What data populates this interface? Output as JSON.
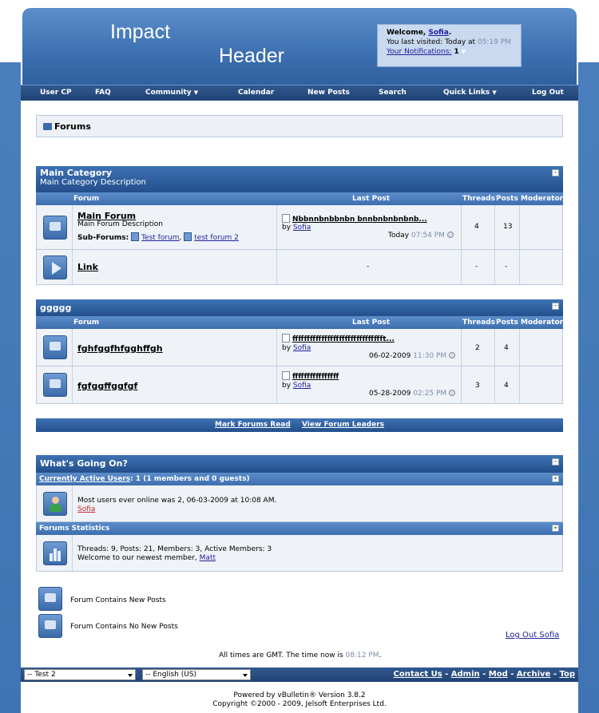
{
  "header": {
    "logo_line1": "Impact",
    "logo_line2": "Header",
    "welcome_prefix": "Welcome, ",
    "welcome_user": "Sofia",
    "last_visited_label": "You last visited: Today at ",
    "last_visited_time": "05:19 PM",
    "notifications_label": "Your Notifications:",
    "notifications_count": "1"
  },
  "nav": [
    "User CP",
    "FAQ",
    "Community",
    "Calendar",
    "New Posts",
    "Search",
    "Quick Links",
    "Log Out"
  ],
  "breadcrumb": "Forums",
  "columns": {
    "forum": "Forum",
    "last_post": "Last Post",
    "threads": "Threads",
    "posts": "Posts",
    "moderator": "Moderator"
  },
  "category1": {
    "title": "Main Category",
    "description": "Main Category Description",
    "forums": [
      {
        "name": "Main Forum",
        "description": "Main Forum Description",
        "subforums_label": "Sub-Forums:",
        "subforums": [
          "Test forum",
          "test forum 2"
        ],
        "last_post_title": "Nbbnnbnbbnbn bnnbnbnbnbnb...",
        "last_post_by": "by ",
        "last_post_user": "Sofia",
        "last_post_date": "Today",
        "last_post_time": "07:54 PM",
        "threads": "4",
        "posts": "13"
      },
      {
        "name": "Link",
        "last_post": "-",
        "threads": "-",
        "posts": "-"
      }
    ]
  },
  "category2": {
    "title": "ggggg",
    "forums": [
      {
        "name": "fghfggfhfgghffgh",
        "last_post_title": "ffffffffffffffffffffffffffffffft...",
        "last_post_by": "by ",
        "last_post_user": "Sofia",
        "last_post_date": "06-02-2009",
        "last_post_time": "11:30 PM",
        "threads": "2",
        "posts": "4"
      },
      {
        "name": "fgfggffggfgf",
        "last_post_title": "ffffffffffffffff",
        "last_post_by": "by ",
        "last_post_user": "Sofia",
        "last_post_date": "05-28-2009",
        "last_post_time": "02:25 PM",
        "threads": "3",
        "posts": "4"
      }
    ]
  },
  "actions": {
    "mark_read": "Mark Forums Read",
    "view_leaders": "View Forum Leaders"
  },
  "whats_going_on": {
    "title": "What's Going On?",
    "active_users_link": "Currently Active Users",
    "active_users_summary": ": 1 (1 members and 0 guests)",
    "most_users": "Most users ever online was 2, 06-03-2009 at 10:08 AM.",
    "active_user": "Sofia",
    "stats_title": "Forums Statistics",
    "stats_line": "Threads: 9, Posts: 21, Members: 3, Active Members: 3",
    "newest_prefix": "Welcome to our newest member, ",
    "newest_member": "Matt"
  },
  "legend": {
    "new_posts": "Forum Contains New Posts",
    "no_new_posts": "Forum Contains No New Posts"
  },
  "logout_link": "Log Out Sofia",
  "time_prefix": "All times are GMT. The time now is ",
  "time_now": "08:12 PM",
  "time_suffix": ".",
  "footer": {
    "style_select": "-- Test 2",
    "language_select": "-- English (US)",
    "links": [
      "Contact Us",
      "Admin",
      "Mod",
      "Archive",
      "Top"
    ],
    "powered_by": "Powered by vBulletin® Version 3.8.2",
    "copyright": "Copyright ©2000 - 2009, Jelsoft Enterprises Ltd."
  },
  "colors": {
    "page_background": "#4a7fbd",
    "header_dark": "#1f4273",
    "row_background": "#eff2f7",
    "link": "#22229c",
    "time_grey": "#7d8fa8"
  }
}
